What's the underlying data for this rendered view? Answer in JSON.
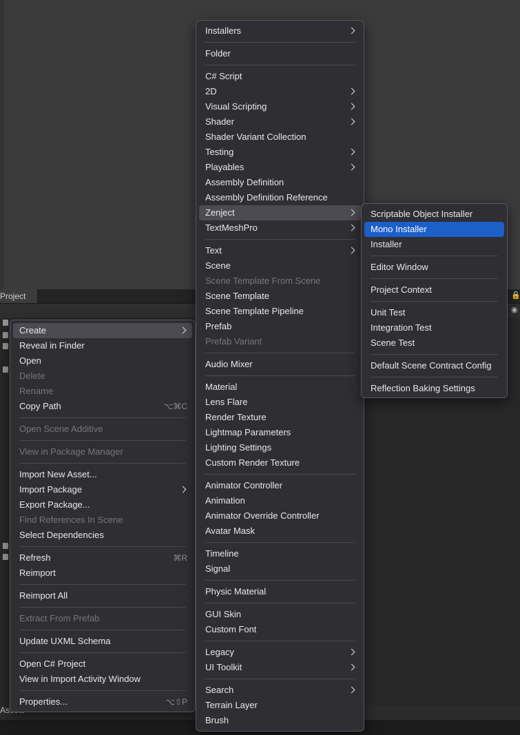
{
  "project_panel": {
    "tab_label": "Project",
    "status_label": "Assets"
  },
  "icons": {
    "lock": "lock-icon",
    "eye": "eye-slash-icon",
    "chevron": "chevron-right-icon"
  },
  "colors": {
    "menu_bg": "#2f2e33",
    "selected": "#1b5fc9",
    "hover": "#4c4b51"
  },
  "context_menu": {
    "items": [
      {
        "label": "Create",
        "submenu": true,
        "state": "hover"
      },
      {
        "label": "Reveal in Finder"
      },
      {
        "label": "Open"
      },
      {
        "label": "Delete",
        "disabled": true
      },
      {
        "label": "Rename",
        "disabled": true
      },
      {
        "label": "Copy Path",
        "shortcut": "⌥⌘C"
      },
      {
        "separator": true
      },
      {
        "label": "Open Scene Additive",
        "disabled": true
      },
      {
        "separator": true
      },
      {
        "label": "View in Package Manager",
        "disabled": true
      },
      {
        "separator": true
      },
      {
        "label": "Import New Asset..."
      },
      {
        "label": "Import Package",
        "submenu": true
      },
      {
        "label": "Export Package..."
      },
      {
        "label": "Find References In Scene",
        "disabled": true
      },
      {
        "label": "Select Dependencies"
      },
      {
        "separator": true
      },
      {
        "label": "Refresh",
        "shortcut": "⌘R"
      },
      {
        "label": "Reimport"
      },
      {
        "separator": true
      },
      {
        "label": "Reimport All"
      },
      {
        "separator": true
      },
      {
        "label": "Extract From Prefab",
        "disabled": true
      },
      {
        "separator": true
      },
      {
        "label": "Update UXML Schema"
      },
      {
        "separator": true
      },
      {
        "label": "Open C# Project"
      },
      {
        "label": "View in Import Activity Window"
      },
      {
        "separator": true
      },
      {
        "label": "Properties...",
        "shortcut": "⌥⇧P"
      }
    ]
  },
  "create_menu": {
    "items": [
      {
        "label": "Installers",
        "submenu": true
      },
      {
        "separator": true
      },
      {
        "label": "Folder"
      },
      {
        "separator": true
      },
      {
        "label": "C# Script"
      },
      {
        "label": "2D",
        "submenu": true
      },
      {
        "label": "Visual Scripting",
        "submenu": true
      },
      {
        "label": "Shader",
        "submenu": true
      },
      {
        "label": "Shader Variant Collection"
      },
      {
        "label": "Testing",
        "submenu": true
      },
      {
        "label": "Playables",
        "submenu": true
      },
      {
        "label": "Assembly Definition"
      },
      {
        "label": "Assembly Definition Reference"
      },
      {
        "label": "Zenject",
        "submenu": true,
        "state": "hover"
      },
      {
        "label": "TextMeshPro",
        "submenu": true
      },
      {
        "separator": true
      },
      {
        "label": "Text",
        "submenu": true
      },
      {
        "label": "Scene"
      },
      {
        "label": "Scene Template From Scene",
        "disabled": true
      },
      {
        "label": "Scene Template"
      },
      {
        "label": "Scene Template Pipeline"
      },
      {
        "label": "Prefab"
      },
      {
        "label": "Prefab Variant",
        "disabled": true
      },
      {
        "separator": true
      },
      {
        "label": "Audio Mixer"
      },
      {
        "separator": true
      },
      {
        "label": "Material"
      },
      {
        "label": "Lens Flare"
      },
      {
        "label": "Render Texture"
      },
      {
        "label": "Lightmap Parameters"
      },
      {
        "label": "Lighting Settings"
      },
      {
        "label": "Custom Render Texture"
      },
      {
        "separator": true
      },
      {
        "label": "Animator Controller"
      },
      {
        "label": "Animation"
      },
      {
        "label": "Animator Override Controller"
      },
      {
        "label": "Avatar Mask"
      },
      {
        "separator": true
      },
      {
        "label": "Timeline"
      },
      {
        "label": "Signal"
      },
      {
        "separator": true
      },
      {
        "label": "Physic Material"
      },
      {
        "separator": true
      },
      {
        "label": "GUI Skin"
      },
      {
        "label": "Custom Font"
      },
      {
        "separator": true
      },
      {
        "label": "Legacy",
        "submenu": true
      },
      {
        "label": "UI Toolkit",
        "submenu": true
      },
      {
        "separator": true
      },
      {
        "label": "Search",
        "submenu": true
      },
      {
        "label": "Terrain Layer"
      },
      {
        "label": "Brush"
      }
    ]
  },
  "zenject_menu": {
    "items": [
      {
        "label": "Scriptable Object Installer"
      },
      {
        "label": "Mono Installer",
        "state": "selected"
      },
      {
        "label": "Installer"
      },
      {
        "separator": true
      },
      {
        "label": "Editor Window"
      },
      {
        "separator": true
      },
      {
        "label": "Project Context"
      },
      {
        "separator": true
      },
      {
        "label": "Unit Test"
      },
      {
        "label": "Integration Test"
      },
      {
        "label": "Scene Test"
      },
      {
        "separator": true
      },
      {
        "label": "Default Scene Contract Config"
      },
      {
        "separator": true
      },
      {
        "label": "Reflection Baking Settings"
      }
    ]
  }
}
